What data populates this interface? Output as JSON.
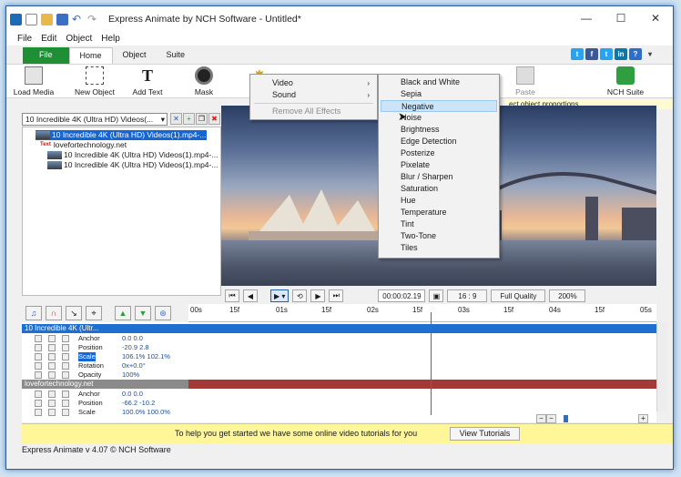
{
  "window": {
    "title": "Express Animate by NCH Software - Untitled*"
  },
  "menu": [
    "File",
    "Edit",
    "Object",
    "Help"
  ],
  "tabs": {
    "file": "File",
    "home": "Home",
    "object": "Object",
    "suite": "Suite"
  },
  "social": [
    "t",
    "f",
    "t",
    "in"
  ],
  "ribbon": {
    "load_media": "Load Media",
    "new_object": "New Object",
    "add_text": "Add Text",
    "mask": "Mask",
    "paste": "Paste",
    "nch_suite": "NCH Suite"
  },
  "hint": "Drag handles to resize. Hold Shift to maintain object proportions.",
  "hint_visible": "ect object proportions.",
  "objects": {
    "selector": "10 Incredible 4K (Ultra HD) Videos(...",
    "items": [
      "10 Incredible 4K (Ultra HD) Videos(1).mp4-...",
      "lovefortechnology.net",
      "10 Incredible 4K (Ultra HD) Videos(1).mp4-...",
      "10 Incredible 4K (Ultra HD) Videos(1).mp4-..."
    ]
  },
  "context_menu": {
    "items": [
      {
        "label": "Video",
        "has_submenu": true
      },
      {
        "label": "Sound",
        "has_submenu": true
      },
      {
        "label": "Remove All Effects",
        "disabled": true
      }
    ],
    "submenu": [
      "Black and White",
      "Sepia",
      "Negative",
      "Noise",
      "Brightness",
      "Edge Detection",
      "Posterize",
      "Pixelate",
      "Blur / Sharpen",
      "Saturation",
      "Hue",
      "Temperature",
      "Tint",
      "Two-Tone",
      "Tiles"
    ],
    "highlighted": "Negative"
  },
  "transport": {
    "time": "00:00:02.19",
    "aspect": "16 : 9",
    "quality": "Full Quality",
    "zoom": "200%"
  },
  "ruler": [
    "00s",
    "15f",
    "01s",
    "15f",
    "02s",
    "15f",
    "03s",
    "15f",
    "04s",
    "15f",
    "05s"
  ],
  "tracks": [
    {
      "name": "10 Incredible 4K (Ultr...",
      "props": [
        {
          "name": "Anchor",
          "value": "0.0  0.0"
        },
        {
          "name": "Position",
          "value": "-20.9  2.8"
        },
        {
          "name": "Scale",
          "value": "106.1%  102.1%"
        },
        {
          "name": "Rotation",
          "value": "0x+0.0°"
        },
        {
          "name": "Opacity",
          "value": "100%"
        }
      ]
    },
    {
      "name": "lovefortechnology.net",
      "props": [
        {
          "name": "Anchor",
          "value": "0.0  0.0"
        },
        {
          "name": "Position",
          "value": "-66.2  -10.2"
        },
        {
          "name": "Scale",
          "value": "100.0%  100.0%"
        }
      ]
    }
  ],
  "tutorial": {
    "message": "To help you get started we have some online video tutorials for you",
    "button": "View Tutorials"
  },
  "status": "Express Animate v 4.07 © NCH Software",
  "colors": {
    "file_tab": "#1f8f35",
    "selection": "#1465d6",
    "track1": "#1e6fcf",
    "track2": "#a23a3a",
    "tutorial_bar": "#fff69a"
  }
}
